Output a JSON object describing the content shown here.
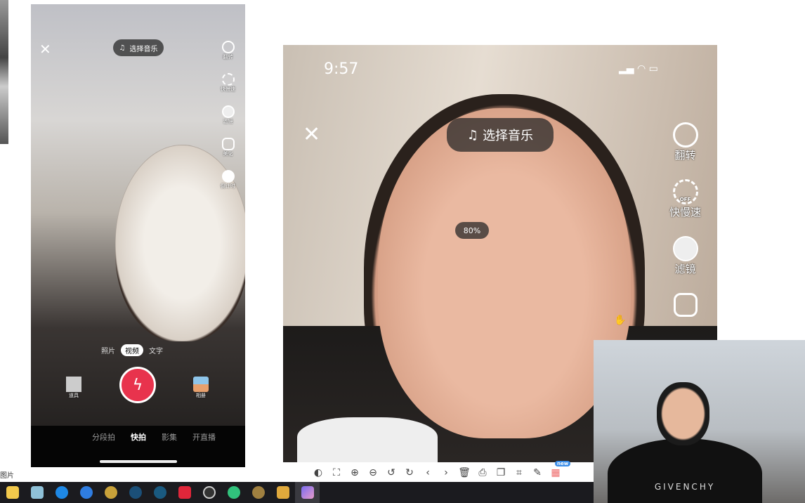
{
  "left_label": "图片",
  "phone": {
    "music_label": "选择音乐",
    "side": [
      "翻转",
      "快慢速",
      "滤镜",
      "美化",
      "倒计时"
    ],
    "modes": [
      "照片",
      "视频",
      "文字"
    ],
    "active_mode": "视频",
    "props_label": "道具",
    "album_label": "相册",
    "tabs": [
      "分段拍",
      "快拍",
      "影集",
      "开直播"
    ],
    "active_tab": "快拍",
    "record_color": "#e8334d"
  },
  "main": {
    "time": "9:57",
    "music_label": "选择音乐",
    "zoom_badge": "80%",
    "side": [
      "翻转",
      "快慢速",
      "滤镜"
    ],
    "speed_off": "OFF"
  },
  "toolbar": {
    "new_badge": "new"
  },
  "webcam": {
    "shirt_text": "GIVENCHY"
  }
}
